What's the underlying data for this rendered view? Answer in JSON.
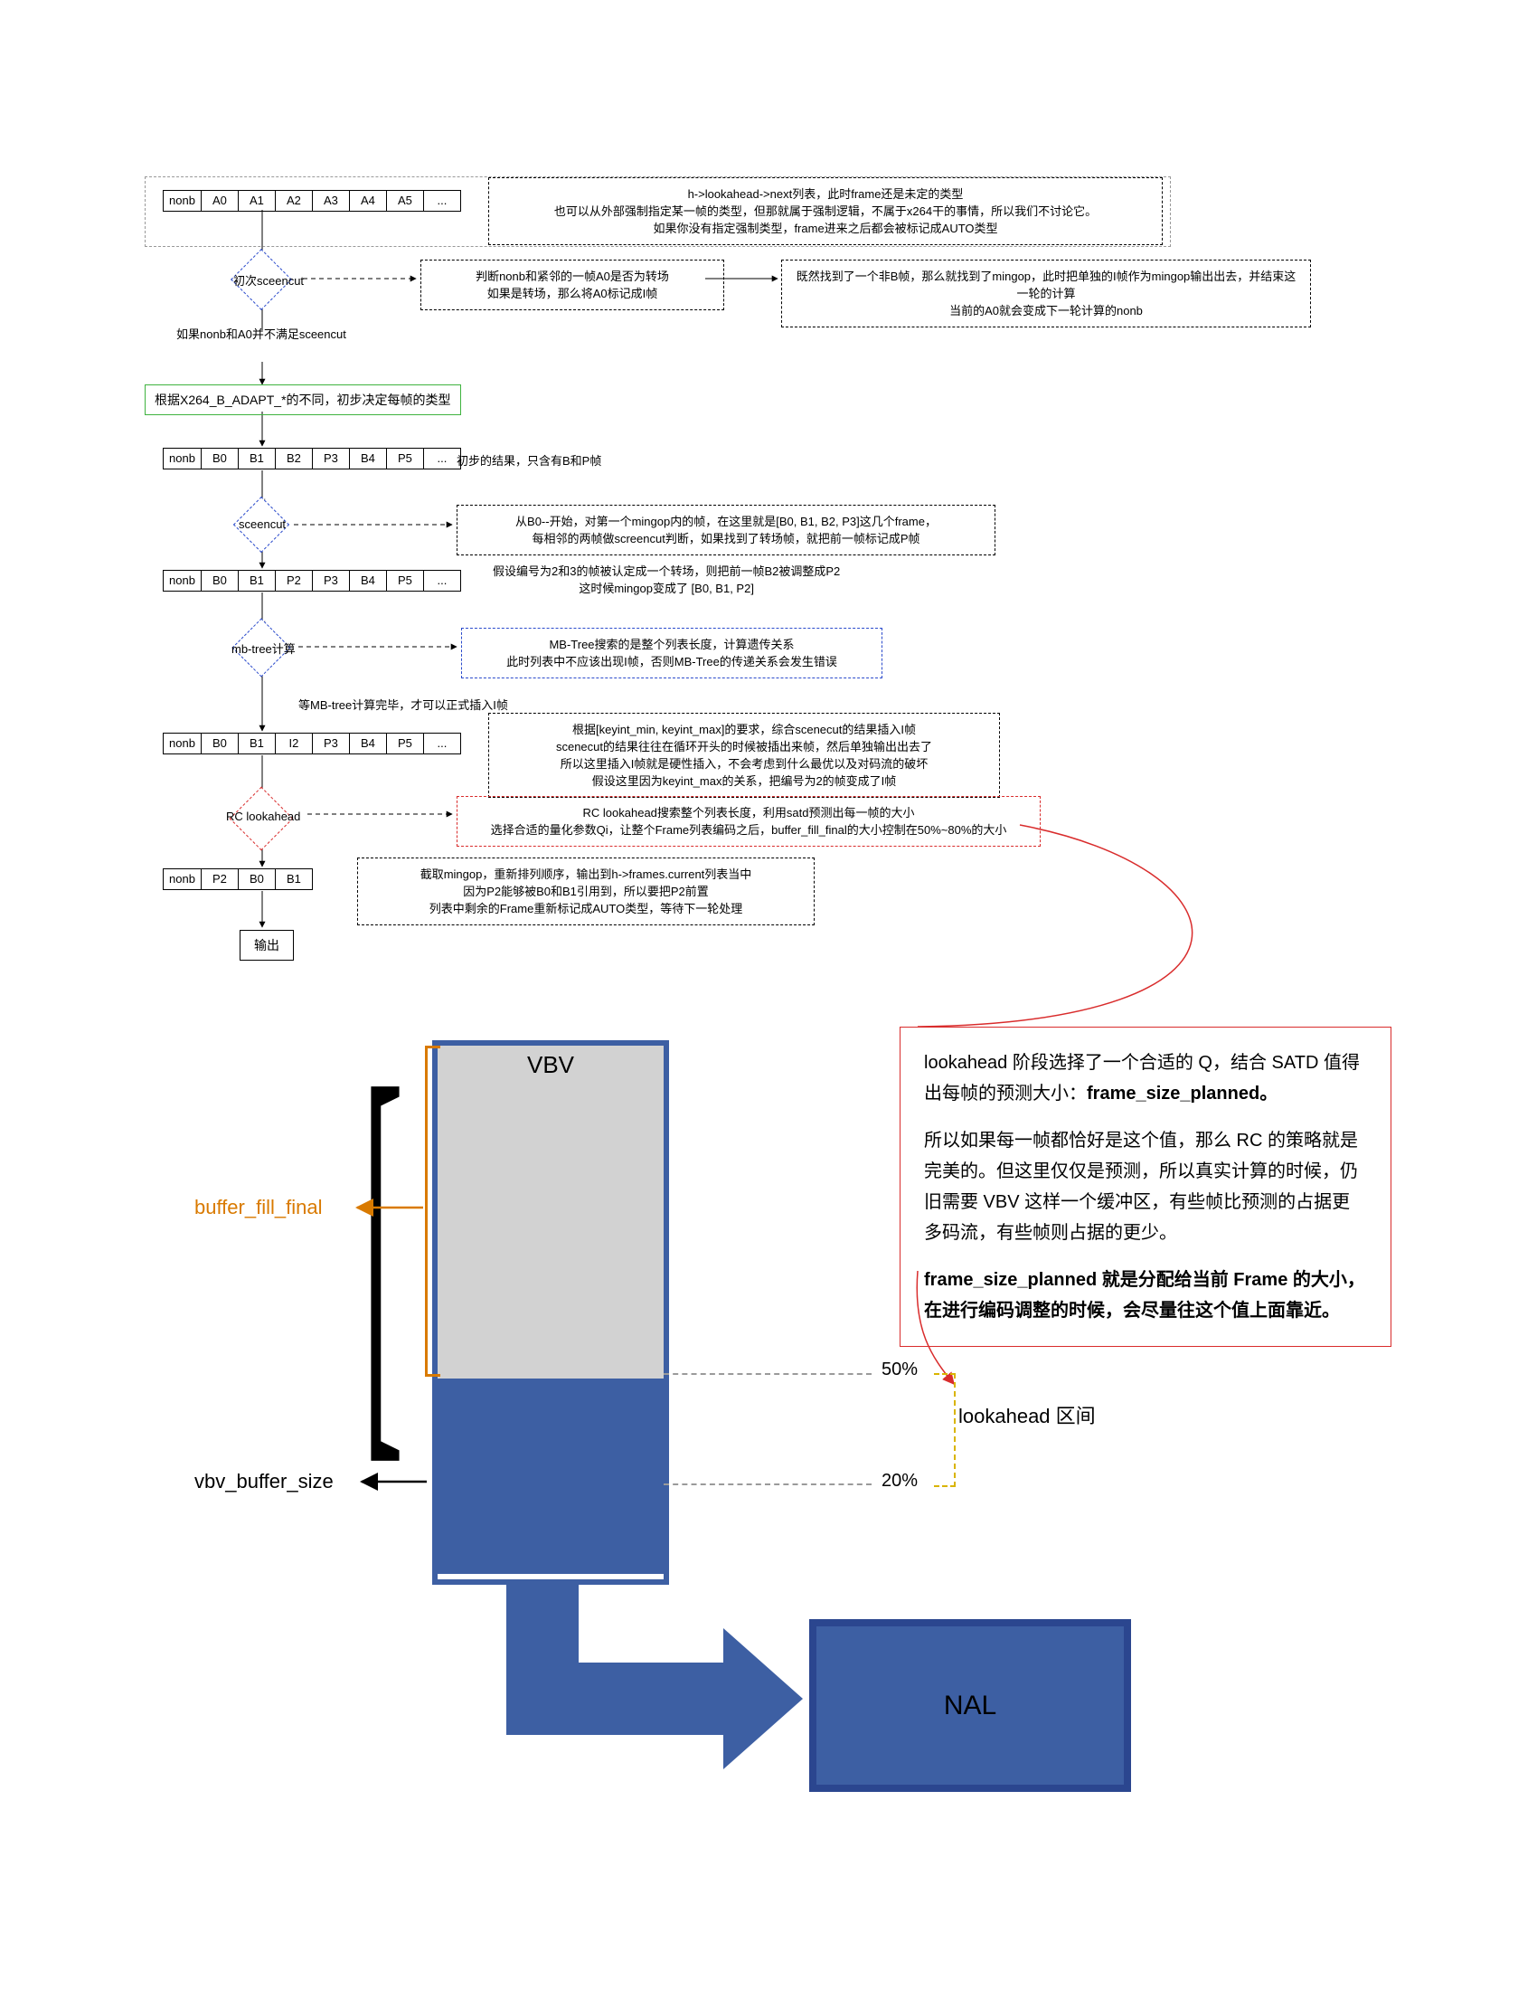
{
  "flow": {
    "row1": {
      "cells": [
        "nonb",
        "A0",
        "A1",
        "A2",
        "A3",
        "A4",
        "A5",
        "..."
      ]
    },
    "note1_l1": "h->lookahead->next列表，此时frame还是未定的类型",
    "note1_l2": "也可以从外部强制指定某一帧的类型，但那就属于强制逻辑，不属于x264干的事情，所以我们不讨论它。",
    "note1_l3": "如果你没有指定强制类型，frame进来之后都会被标记成AUTO类型",
    "d1": "初次sceencut",
    "d1_side": "判断nonb和紧邻的一帧A0是否为转场\n如果是转场，那么将A0标记成I帧",
    "d1_side2": "既然找到了一个非B帧，那么就找到了mingop，此时把单独的I帧作为mingop输出出去，并结束这一轮的计算\n当前的A0就会变成下一轮计算的nonb",
    "d1_below": "如果nonb和A0并不满足sceencut",
    "green": "根据X264_B_ADAPT_*的不同，初步决定每帧的类型",
    "row2": {
      "cells": [
        "nonb",
        "B0",
        "B1",
        "B2",
        "P3",
        "B4",
        "P5",
        "..."
      ]
    },
    "row2_note": "初步的结果，只含有B和P帧",
    "d2": "sceencut",
    "d2_side": "从B0--开始，对第一个mingop内的帧，在这里就是[B0, B1, B2, P3]这几个frame，\n每相邻的两帧做screencut判断，如果找到了转场帧，就把前一帧标记成P帧",
    "row3": {
      "cells": [
        "nonb",
        "B0",
        "B1",
        "P2",
        "P3",
        "B4",
        "P5",
        "..."
      ]
    },
    "row3_note": "假设编号为2和3的帧被认定成一个转场，则把前一帧B2被调整成P2\n这时候mingop变成了 [B0, B1, P2]",
    "d3": "mb-tree计算",
    "d3_side": "MB-Tree搜索的是整个列表长度，计算遗传关系\n此时列表中不应该出现I帧，否则MB-Tree的传递关系会发生错误",
    "d3_below": "等MB-tree计算完毕，才可以正式插入I帧",
    "row4": {
      "cells": [
        "nonb",
        "B0",
        "B1",
        "I2",
        "P3",
        "B4",
        "P5",
        "..."
      ]
    },
    "row4_note": "根据[keyint_min, keyint_max]的要求，综合scenecut的结果插入I帧\nscenecut的结果往往在循环开头的时候被插出来帧，然后单独输出出去了\n所以这里插入I帧就是硬性插入，不会考虑到什么最优以及对码流的破坏\n假设这里因为keyint_max的关系，把编号为2的帧变成了I帧",
    "d4": "RC lookahead",
    "d4_side": "RC lookahead搜索整个列表长度，利用satd预测出每一帧的大小\n选择合适的量化参数Qi，让整个Frame列表编码之后，buffer_fill_final的大小控制在50%~80%的大小",
    "row5": {
      "cells": [
        "nonb",
        "P2",
        "B0",
        "B1"
      ]
    },
    "row5_note": "截取mingop，重新排列顺序，输出到h->frames.current列表当中\n因为P2能够被B0和B1引用到，所以要把P2前置\n列表中剩余的Frame重新标记成AUTO类型，等待下一轮处理",
    "out": "输出"
  },
  "redbox": {
    "p1a": "lookahead 阶段选择了一个合适的 Q，结合 SATD 值得出每帧的预测大小：",
    "p1b": "frame_size_planned。",
    "p2": "所以如果每一帧都恰好是这个值，那么 RC 的策略就是完美的。但这里仅仅是预测，所以真实计算的时候，仍旧需要 VBV 这样一个缓冲区，有些帧比预测的占据更多码流，有些帧则占据的更少。",
    "p3": "frame_size_planned 就是分配给当前 Frame 的大小，在进行编码调整的时候，会尽量往这个值上面靠近。"
  },
  "vbv": {
    "title": "VBV",
    "buffer_fill_final": "buffer_fill_final",
    "vbv_buffer_size": "vbv_buffer_size",
    "p50": "50%",
    "p20": "20%",
    "lookahead_range": "lookahead 区间",
    "nal": "NAL"
  }
}
